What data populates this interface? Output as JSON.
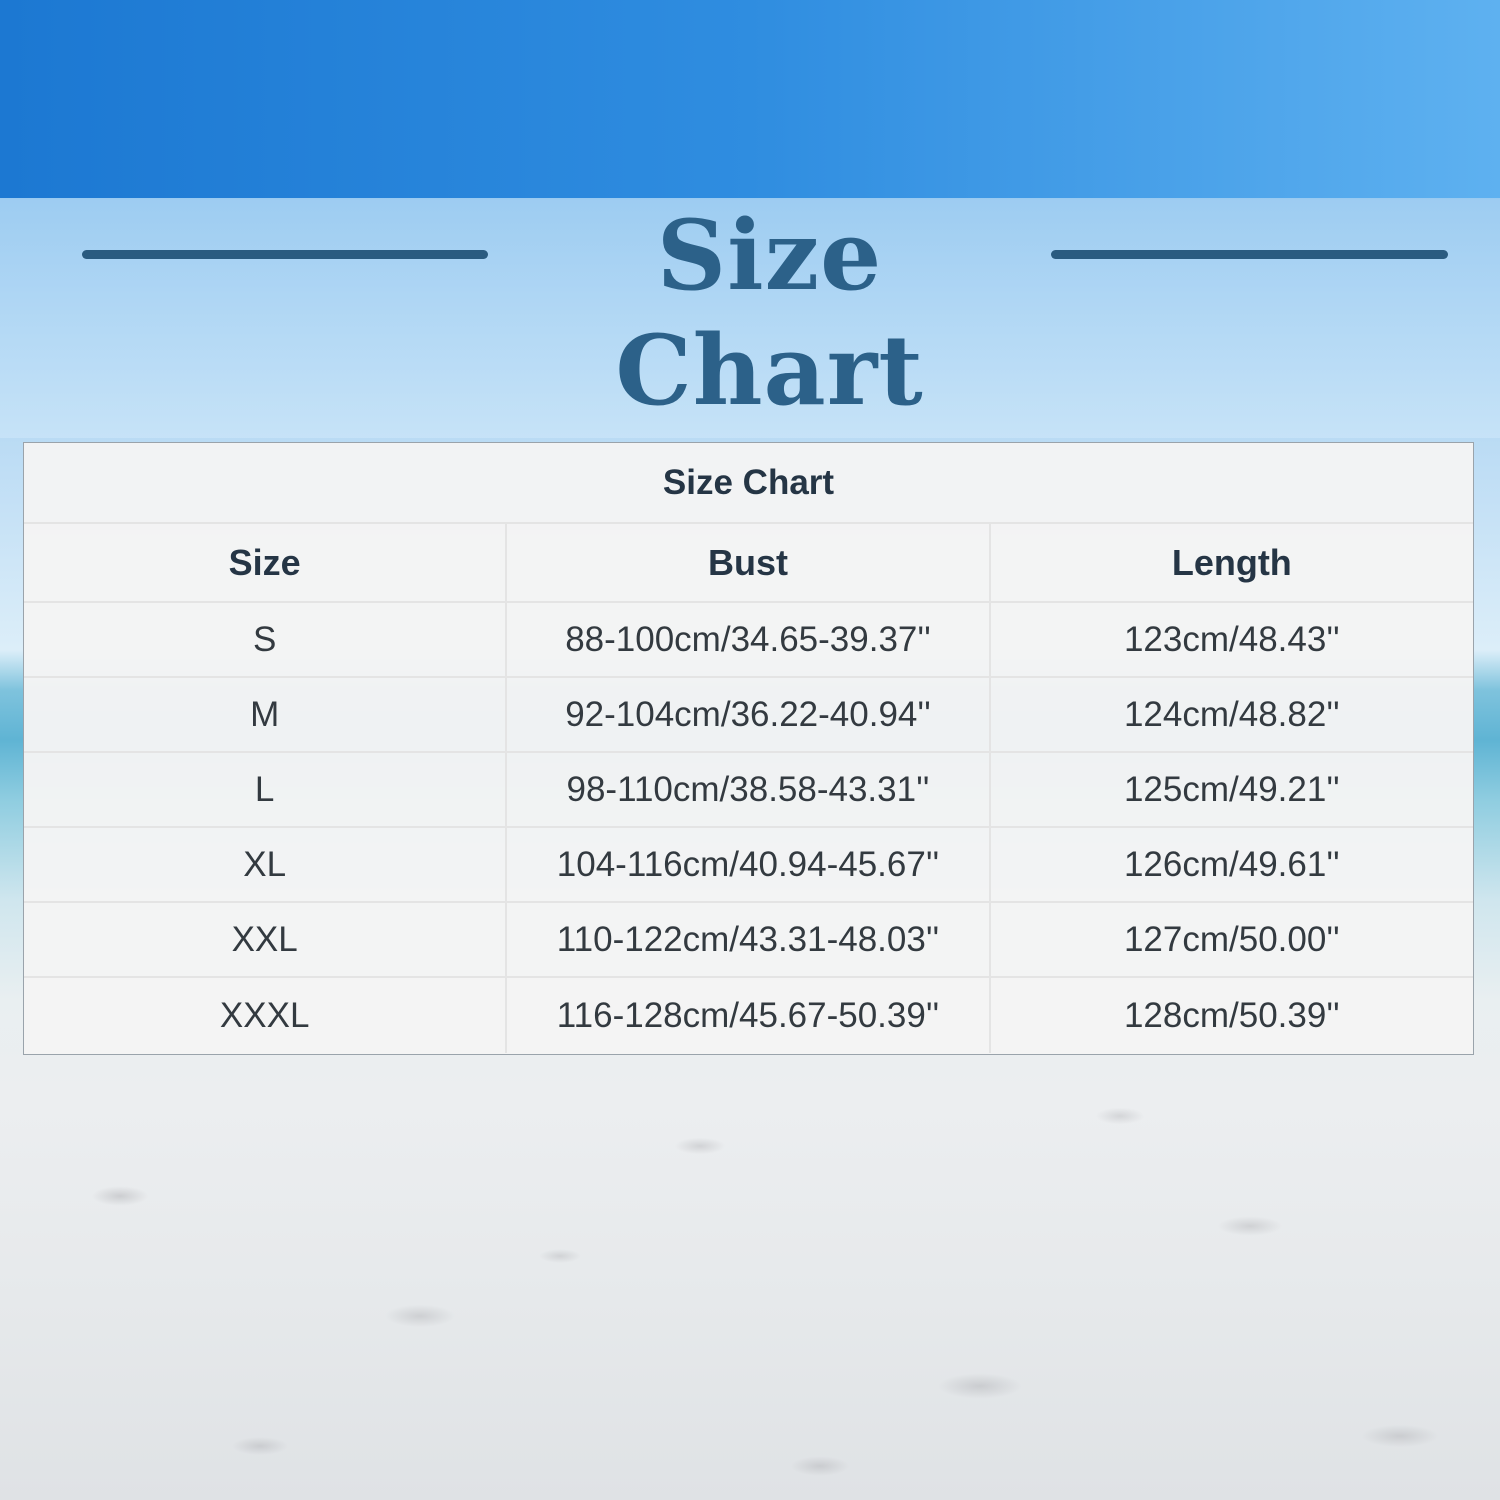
{
  "banner": {
    "title": "Size Chart"
  },
  "table": {
    "caption": "Size Chart",
    "columns": [
      "Size",
      "Bust",
      "Length"
    ],
    "rows": [
      [
        "S",
        "88-100cm/34.65-39.37''",
        "123cm/48.43''"
      ],
      [
        "M",
        "92-104cm/36.22-40.94''",
        "124cm/48.82''"
      ],
      [
        "L",
        "98-110cm/38.58-43.31''",
        "125cm/49.21''"
      ],
      [
        "XL",
        "104-116cm/40.94-45.67''",
        "126cm/49.61''"
      ],
      [
        "XXL",
        "110-122cm/43.31-48.03''",
        "127cm/50.00''"
      ],
      [
        "XXXL",
        "116-128cm/45.67-50.39''",
        "128cm/50.39''"
      ]
    ]
  },
  "colors": {
    "title": "#2c6189",
    "title_lines": "#2a5b80",
    "table_text": "#333a40",
    "table_header": "#253545"
  }
}
